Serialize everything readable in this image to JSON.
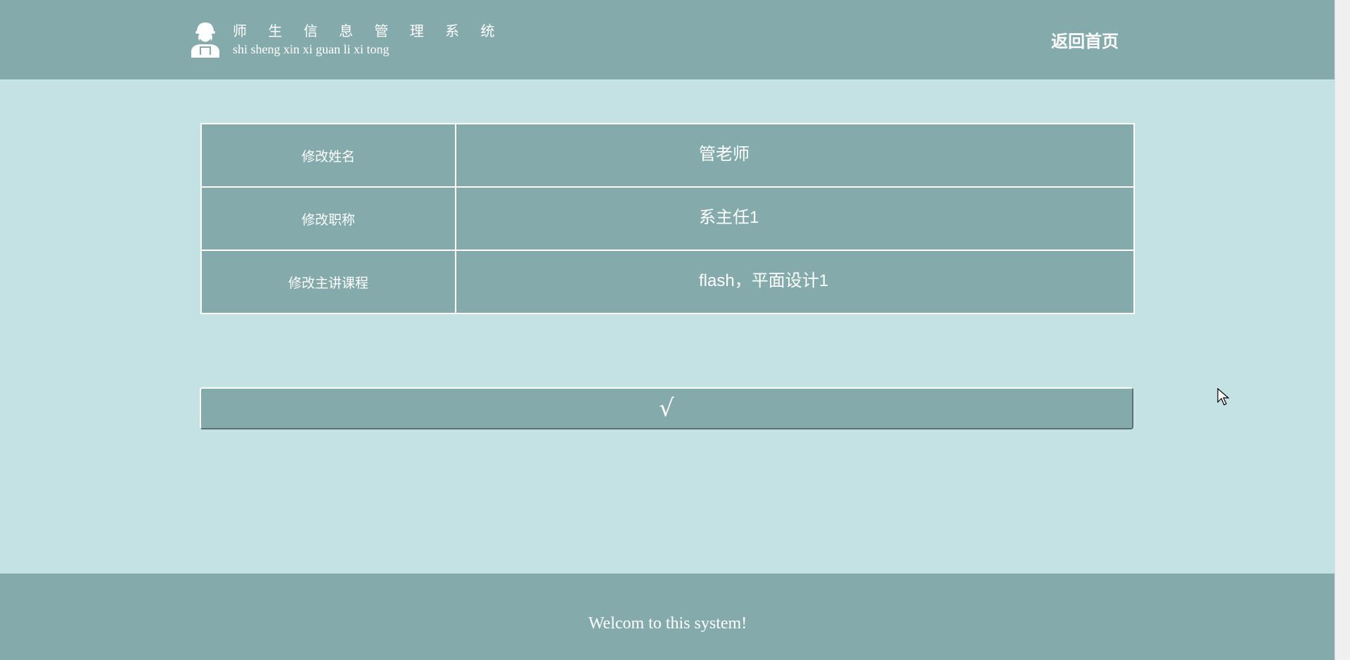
{
  "header": {
    "title": "师 生 信 息 管 理 系 统",
    "subtitle": "shi sheng xin xi guan li xi tong",
    "home_link": "返回首页",
    "logo_icon": "worker-avatar-icon"
  },
  "form": {
    "rows": [
      {
        "label": "修改姓名",
        "value": "管老师"
      },
      {
        "label": "修改职称",
        "value": "系主任1"
      },
      {
        "label": "修改主讲课程",
        "value": "flash，平面设计1"
      }
    ],
    "submit_label": "√"
  },
  "footer": {
    "text": "Welcom to this system!"
  },
  "colors": {
    "header_bg": "#84aaab",
    "page_bg": "#c4e2e4",
    "text": "#ffffff"
  }
}
